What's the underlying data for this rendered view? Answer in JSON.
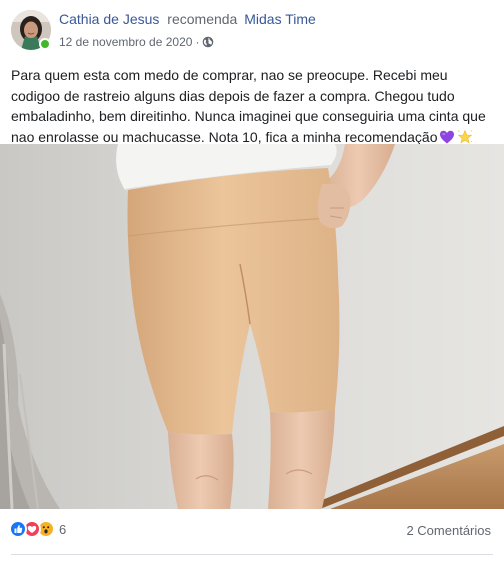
{
  "post": {
    "author": "Cathia de Jesus",
    "action": "recomenda",
    "page": "Midas Time",
    "date": "12 de novembro de 2020",
    "separator": "·",
    "text": "Para quem esta com medo de comprar, nao se preocupe. Recebi meu codigoo de rastreio alguns dias depois de fazer a compra. Chegou tudo embaladinho, bem direitinho. Nunca imaginei que conseguiria uma cinta que nao enrolasse ou machucasse. Nota 10, fica a minha recomendação",
    "emojis": [
      "purple-heart-icon",
      "glowing-star-icon"
    ]
  },
  "footer": {
    "reaction_icons": [
      "like-icon",
      "love-icon",
      "wow-icon"
    ],
    "reaction_count": "6",
    "comments": "2 Comentários"
  },
  "colors": {
    "link": "#385898",
    "secondary_text": "#606770",
    "online": "#42b72a",
    "like": "#1877f2",
    "love": "#f33e58",
    "wow": "#f7b125"
  }
}
